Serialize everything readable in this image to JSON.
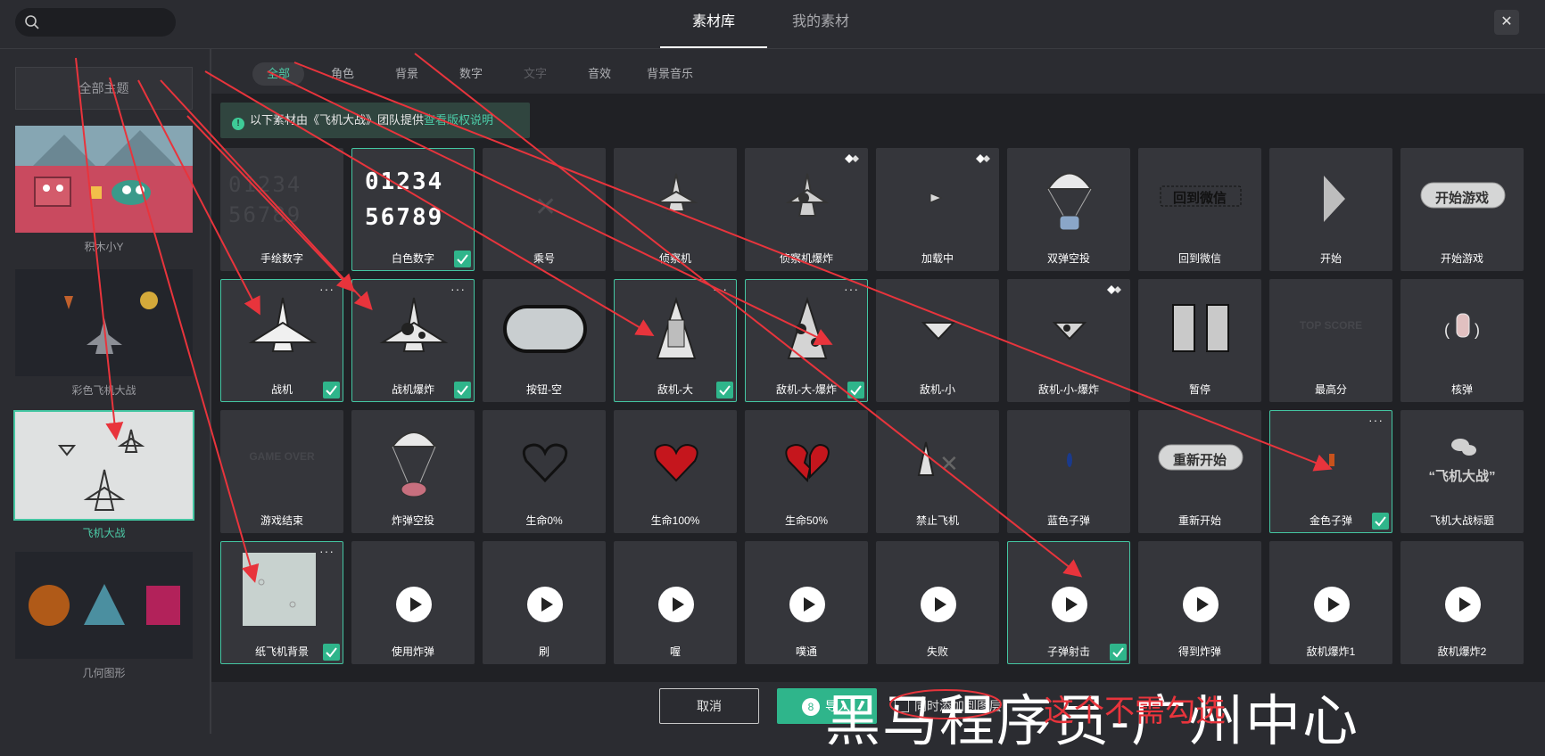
{
  "search": {
    "placeholder": ""
  },
  "main_tabs": [
    {
      "label": "素材库",
      "active": true
    },
    {
      "label": "我的素材",
      "active": false
    }
  ],
  "sidebar": {
    "all_themes": "全部主题",
    "themes": [
      {
        "label": "积木小Y",
        "active": false
      },
      {
        "label": "彩色飞机大战",
        "active": false
      },
      {
        "label": "飞机大战",
        "active": true
      },
      {
        "label": "几何图形",
        "active": false
      }
    ]
  },
  "categories": [
    {
      "label": "全部",
      "state": "active"
    },
    {
      "label": "角色",
      "state": "normal"
    },
    {
      "label": "背景",
      "state": "normal"
    },
    {
      "label": "数字",
      "state": "normal"
    },
    {
      "label": "文字",
      "state": "disabled"
    },
    {
      "label": "音效",
      "state": "normal"
    },
    {
      "label": "背景音乐",
      "state": "normal"
    }
  ],
  "notice": {
    "text": "以下素材由《飞机大战》团队提供",
    "link": "查看版权说明",
    "info_icon": "info-icon"
  },
  "assets": [
    {
      "name": "手绘数字",
      "art": "handdrawn-digits",
      "selected": false
    },
    {
      "name": "白色数字",
      "art": "white-digits",
      "selected": true,
      "digits_top": "01234",
      "digits_bottom": "56789"
    },
    {
      "name": "乘号",
      "art": "multiply",
      "selected": false
    },
    {
      "name": "侦察机",
      "art": "scout-plane",
      "selected": false
    },
    {
      "name": "侦察机爆炸",
      "art": "scout-explode",
      "selected": false,
      "diamond": true
    },
    {
      "name": "加载中",
      "art": "loading",
      "selected": false,
      "diamond": true
    },
    {
      "name": "双弹空投",
      "art": "parachute",
      "selected": false
    },
    {
      "name": "回到微信",
      "art": "back-wechat",
      "selected": false,
      "inner": "回到微信"
    },
    {
      "name": "开始",
      "art": "start-arrow",
      "selected": false
    },
    {
      "name": "开始游戏",
      "art": "start-game",
      "selected": false,
      "inner": "开始游戏"
    },
    {
      "name": "战机",
      "art": "fighter",
      "selected": true,
      "more": true
    },
    {
      "name": "战机爆炸",
      "art": "fighter-explode",
      "selected": true,
      "more": true
    },
    {
      "name": "按钮-空",
      "art": "empty-button",
      "selected": false
    },
    {
      "name": "敌机-大",
      "art": "enemy-big",
      "selected": true,
      "more": true
    },
    {
      "name": "敌机-大-爆炸",
      "art": "enemy-big-explode",
      "selected": true,
      "more": true
    },
    {
      "name": "敌机-小",
      "art": "enemy-small",
      "selected": false
    },
    {
      "name": "敌机-小-爆炸",
      "art": "enemy-small-explode",
      "selected": false,
      "diamond": true
    },
    {
      "name": "暂停",
      "art": "pause",
      "selected": false
    },
    {
      "name": "最高分",
      "art": "top-score",
      "selected": false,
      "inner": "TOP SCORE"
    },
    {
      "name": "核弹",
      "art": "nuke",
      "selected": false
    },
    {
      "name": "游戏结束",
      "art": "game-over",
      "selected": false,
      "inner": "GAME OVER"
    },
    {
      "name": "炸弹空投",
      "art": "bomb-parachute",
      "selected": false
    },
    {
      "name": "生命0%",
      "art": "heart-empty",
      "selected": false
    },
    {
      "name": "生命100%",
      "art": "heart-full",
      "selected": false
    },
    {
      "name": "生命50%",
      "art": "heart-half",
      "selected": false
    },
    {
      "name": "禁止飞机",
      "art": "no-plane",
      "selected": false
    },
    {
      "name": "蓝色子弹",
      "art": "blue-bullet",
      "selected": false
    },
    {
      "name": "重新开始",
      "art": "restart",
      "selected": false,
      "inner": "重新开始"
    },
    {
      "name": "金色子弹",
      "art": "gold-bullet",
      "selected": true,
      "more": true
    },
    {
      "name": "飞机大战标题",
      "art": "title",
      "selected": false,
      "inner": "“飞机大战”"
    },
    {
      "name": "纸飞机背景",
      "art": "paper-bg",
      "selected": true,
      "more": true
    },
    {
      "name": "使用炸弹",
      "art": "sound",
      "selected": false
    },
    {
      "name": "刷",
      "art": "sound",
      "selected": false
    },
    {
      "name": "喔",
      "art": "sound",
      "selected": false
    },
    {
      "name": "噗通",
      "art": "sound",
      "selected": false
    },
    {
      "name": "失败",
      "art": "sound",
      "selected": false
    },
    {
      "name": "子弹射击",
      "art": "sound",
      "selected": true
    },
    {
      "name": "得到炸弹",
      "art": "sound",
      "selected": false
    },
    {
      "name": "敌机爆炸1",
      "art": "sound",
      "selected": false
    },
    {
      "name": "敌机爆炸2",
      "art": "sound",
      "selected": false
    }
  ],
  "footer": {
    "cancel": "取消",
    "import_count": "8",
    "import": "导入",
    "add_to_layer": "同时添加到图层",
    "watermark": "黑马程序员-广州中心",
    "note": "这个不需勾选"
  },
  "colors": {
    "accent": "#44c6a2",
    "annotation": "#e8343c"
  }
}
